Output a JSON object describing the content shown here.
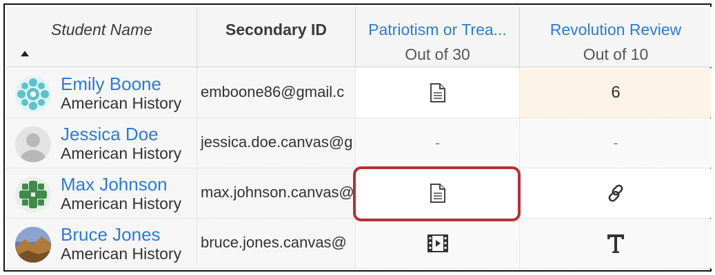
{
  "header": {
    "student_name": "Student Name",
    "secondary_id": "Secondary ID",
    "assignments": [
      {
        "title": "Patriotism or Trea...",
        "points": "Out of 30"
      },
      {
        "title": "Revolution Review",
        "points": "Out of 10"
      }
    ]
  },
  "rows": [
    {
      "name": "Emily Boone",
      "section": "American History",
      "secondary_id": "emboone86@gmail.c",
      "cells": [
        {
          "icon": "document-icon"
        },
        {
          "text": "6"
        }
      ]
    },
    {
      "name": "Jessica Doe",
      "section": "American History",
      "secondary_id": "jessica.doe.canvas@g",
      "cells": [
        {
          "text": "-"
        },
        {
          "text": "-"
        }
      ]
    },
    {
      "name": "Max Johnson",
      "section": "American History",
      "secondary_id": "max.johnson.canvas@",
      "cells": [
        {
          "icon": "document-icon"
        },
        {
          "icon": "link-icon"
        }
      ]
    },
    {
      "name": "Bruce Jones",
      "section": "American History",
      "secondary_id": "bruce.jones.canvas@",
      "cells": [
        {
          "icon": "media-icon"
        },
        {
          "icon": "text-entry-icon"
        }
      ]
    }
  ],
  "colors": {
    "link": "#2d7bd6",
    "highlight": "#b43035",
    "cell_highlight": "#fdf3e6"
  }
}
